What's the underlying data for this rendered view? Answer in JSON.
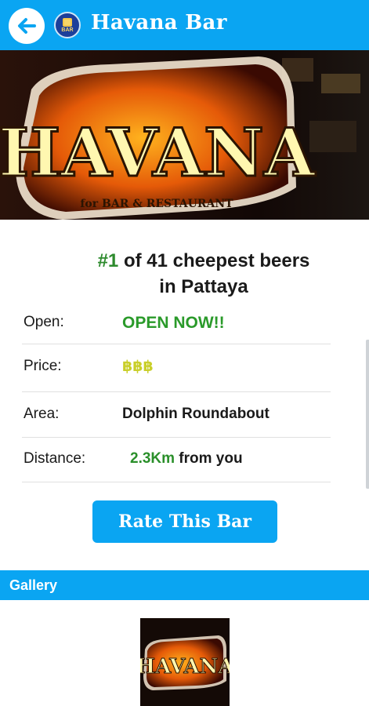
{
  "appbar": {
    "title": "Havana Bar",
    "logo_label": "BAR",
    "color": "#0aa5f2"
  },
  "hero": {
    "sign_text": "HAVANA",
    "sign_subtext": "for BAR & RESTAURANT"
  },
  "headline": {
    "rank": "#1",
    "line1_rest": " of 41 cheepest beers",
    "line2": "in Pattaya"
  },
  "details": {
    "open": {
      "label": "Open:",
      "value": "OPEN NOW!!"
    },
    "price": {
      "label": "Price:",
      "value": "฿฿฿"
    },
    "area": {
      "label": "Area:",
      "value": "Dolphin Roundabout"
    },
    "distance": {
      "label": "Distance:",
      "value": "2.3Km",
      "suffix": " from you"
    }
  },
  "actions": {
    "rate_label": "Rate This Bar"
  },
  "gallery": {
    "title": "Gallery",
    "thumb_sign_text": "HAVANA"
  },
  "colors": {
    "accent": "#0aa5f2",
    "open_green": "#2a9a2a",
    "price_yellow": "#c9cf2a"
  },
  "icons": {
    "back": "arrow-left-icon",
    "logo": "beer-mug-icon"
  }
}
